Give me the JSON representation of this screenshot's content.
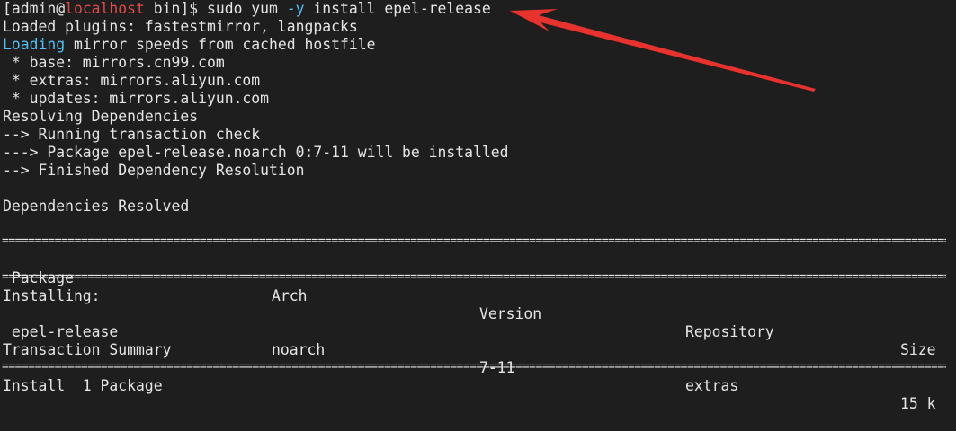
{
  "prompt": {
    "open": "[admin@",
    "host": "localhost",
    "rest": " bin]$ ",
    "cmd1": "sudo yum ",
    "flag": "-y",
    "cmd2": " install epel-release"
  },
  "output": {
    "plugins": "Loaded plugins: fastestmirror, langpacks",
    "loading_word": "Loading",
    "loading_rest": " mirror speeds from cached hostfile",
    "base": " * base: mirrors.cn99.com",
    "extras": " * extras: mirrors.aliyun.com",
    "updates": " * updates: mirrors.aliyun.com",
    "resolving": "Resolving Dependencies",
    "running": "--> Running transaction check",
    "package": "---> Package epel-release.noarch 0:7-11 will be installed",
    "finished": "--> Finished Dependency Resolution",
    "resolved": "Dependencies Resolved",
    "separator": "==================================================================================================================================================",
    "table": {
      "headers": [
        " Package",
        "Arch",
        "Version",
        "Repository",
        "Size"
      ],
      "section": "Installing:",
      "row": [
        " epel-release",
        "noarch",
        "7-11",
        "extras",
        "15 k"
      ]
    },
    "summary_title": "Transaction Summary",
    "install_line": "Install  1 Package"
  },
  "colors": {
    "background": "#1e1e1e",
    "text": "#e6e6e6",
    "hostname": "#e14b4b",
    "highlight": "#4fc3f7",
    "annotation_arrow": "#e8322d"
  }
}
